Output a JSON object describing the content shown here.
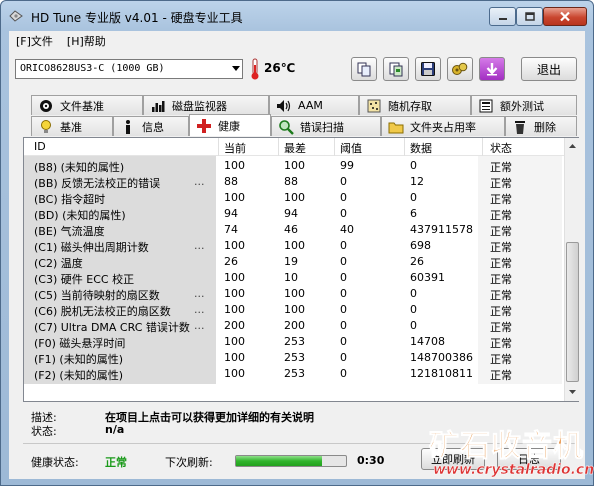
{
  "window": {
    "title": "HD Tune 专业版 v4.01 - 硬盘专业工具"
  },
  "menu": {
    "file": "[F]文件",
    "help": "[H]帮助"
  },
  "toolbar": {
    "drive": "ORICO8628US3-C (1000 GB)",
    "temperature": "26℃",
    "exit_label": "退出",
    "icons": [
      "copy-icon",
      "copy-screenshot-icon",
      "save-icon",
      "options-icon",
      "download-icon"
    ]
  },
  "tabs": {
    "top": [
      {
        "label": "文件基准",
        "icon": "file-benchmark-icon"
      },
      {
        "label": "磁盘监视器",
        "icon": "disk-monitor-icon"
      },
      {
        "label": "AAM",
        "icon": "speaker-icon"
      },
      {
        "label": "随机存取",
        "icon": "random-access-icon"
      },
      {
        "label": "额外测试",
        "icon": "extra-tests-icon"
      }
    ],
    "bottom": [
      {
        "label": "基准",
        "icon": "benchmark-icon"
      },
      {
        "label": "信息",
        "icon": "info-icon"
      },
      {
        "label": "健康",
        "icon": "health-cross-icon",
        "active": true
      },
      {
        "label": "错误扫描",
        "icon": "error-scan-icon"
      },
      {
        "label": "文件夹占用率",
        "icon": "folder-usage-icon"
      },
      {
        "label": "删除",
        "icon": "erase-icon"
      }
    ]
  },
  "grid": {
    "headers": {
      "id": "ID",
      "current": "当前",
      "worst": "最差",
      "threshold": "阈值",
      "data": "数据",
      "status": "状态"
    },
    "rows": [
      {
        "id": "(B8) (未知的属性)",
        "dots": "",
        "current": "100",
        "worst": "100",
        "threshold": "99",
        "data": "0",
        "status": "正常"
      },
      {
        "id": "(BB) 反馈无法校正的错误",
        "dots": "...",
        "current": "88",
        "worst": "88",
        "threshold": "0",
        "data": "12",
        "status": "正常"
      },
      {
        "id": "(BC) 指令超时",
        "dots": "",
        "current": "100",
        "worst": "100",
        "threshold": "0",
        "data": "0",
        "status": "正常"
      },
      {
        "id": "(BD) (未知的属性)",
        "dots": "",
        "current": "94",
        "worst": "94",
        "threshold": "0",
        "data": "6",
        "status": "正常"
      },
      {
        "id": "(BE) 气流温度",
        "dots": "",
        "current": "74",
        "worst": "46",
        "threshold": "40",
        "data": "437911578",
        "status": "正常"
      },
      {
        "id": "(C1) 磁头伸出周期计数",
        "dots": "...",
        "current": "100",
        "worst": "100",
        "threshold": "0",
        "data": "698",
        "status": "正常"
      },
      {
        "id": "(C2) 温度",
        "dots": "",
        "current": "26",
        "worst": "19",
        "threshold": "0",
        "data": "26",
        "status": "正常"
      },
      {
        "id": "(C3) 硬件 ECC 校正",
        "dots": "",
        "current": "100",
        "worst": "10",
        "threshold": "0",
        "data": "60391",
        "status": "正常"
      },
      {
        "id": "(C5) 当前待映射的扇区数",
        "dots": "...",
        "current": "100",
        "worst": "100",
        "threshold": "0",
        "data": "0",
        "status": "正常"
      },
      {
        "id": "(C6) 脱机无法校正的扇区数",
        "dots": "...",
        "current": "100",
        "worst": "100",
        "threshold": "0",
        "data": "0",
        "status": "正常"
      },
      {
        "id": "(C7) Ultra DMA CRC 错误计数",
        "dots": "...",
        "current": "200",
        "worst": "200",
        "threshold": "0",
        "data": "0",
        "status": "正常"
      },
      {
        "id": "(F0) 磁头悬浮时间",
        "dots": "",
        "current": "100",
        "worst": "253",
        "threshold": "0",
        "data": "14708",
        "status": "正常"
      },
      {
        "id": "(F1) (未知的属性)",
        "dots": "",
        "current": "100",
        "worst": "253",
        "threshold": "0",
        "data": "148700386",
        "status": "正常"
      },
      {
        "id": "(F2) (未知的属性)",
        "dots": "",
        "current": "100",
        "worst": "253",
        "threshold": "0",
        "data": "121810811",
        "status": "正常"
      }
    ]
  },
  "description": {
    "desc_label": "描述:",
    "desc_value": "在项目上点击可以获得更加详细的有关说明",
    "status_label": "状态:",
    "status_value": "n/a"
  },
  "bottom": {
    "health_label": "健康状态:",
    "health_value": "正常",
    "refresh_label": "下次刷新:",
    "refresh_progress": 0.78,
    "refresh_time": "0:30",
    "refresh_now_button": "立即刷新",
    "log_button": "日志"
  },
  "watermark": {
    "line1": "矿石收音机",
    "line2": "www.crystalradio.cn"
  },
  "colors": {
    "health_ok": "#1a9a1a",
    "active_tab_icon": "#d02020",
    "progress": "#31b52c"
  }
}
